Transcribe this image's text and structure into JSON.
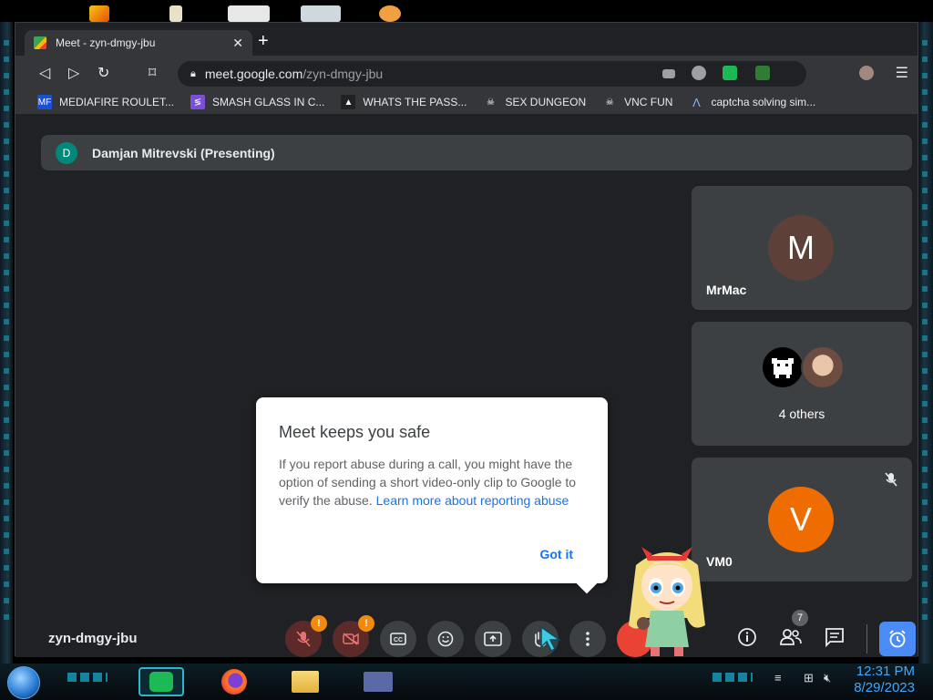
{
  "browser": {
    "tab_title": "Meet - zyn-dmgy-jbu",
    "tab_close": "✕",
    "new_tab": "+",
    "url_host": "meet.google.com",
    "url_path": "/zyn-dmgy-jbu"
  },
  "bookmarks": [
    {
      "label": "MEDIAFIRE ROULET...",
      "icon": "mediafire-icon",
      "color": "#1c4fd8",
      "glyph": "MF"
    },
    {
      "label": "SMASH GLASS IN C...",
      "icon": "visual-studio-icon",
      "color": "#7b4fd6",
      "glyph": "≶"
    },
    {
      "label": "WHATS THE PASS...",
      "icon": "page-icon",
      "color": "#222222",
      "glyph": "▲"
    },
    {
      "label": "SEX DUNGEON",
      "icon": "skull-icon",
      "color": "#35363a",
      "glyph": "☠"
    },
    {
      "label": "VNC FUN",
      "icon": "skull-icon",
      "color": "#35363a",
      "glyph": "☠"
    },
    {
      "label": "captcha solving sim...",
      "icon": "caret-logo-icon",
      "color": "#35363a",
      "glyph": "Λ"
    }
  ],
  "meet": {
    "presenter_initial": "D",
    "presenter_label": "Damjan Mitrevski (Presenting)",
    "tiles": [
      {
        "name": "MrMac",
        "initial": "M",
        "color": "#5d4037"
      },
      {
        "others": "4 others"
      },
      {
        "name": "VM0",
        "initial": "V",
        "color": "#ef6c00"
      }
    ],
    "dialog": {
      "title": "Meet keeps you safe",
      "body": "If you report abuse during a call, you might have the option of sending a short video-only clip to Google to verify the abuse. ",
      "link": "Learn more about reporting abuse",
      "button": "Got it"
    },
    "meeting_code": "zyn-dmgy-jbu",
    "controls": {
      "mic_warning": "!",
      "cam_warning": "!",
      "participant_count": "7"
    }
  },
  "taskbar": {
    "time": "12:31 PM",
    "date": "8/29/2023"
  },
  "colors": {
    "meet_bg": "#202124",
    "tile_bg": "#3c4043",
    "accent_blue": "#1a73e8",
    "alarm_blue": "#4a8bf5"
  }
}
